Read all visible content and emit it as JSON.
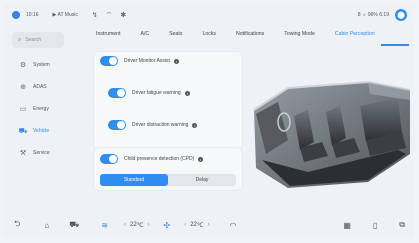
{
  "status_bar": {
    "time": "10:16",
    "media": "▶ AT Music",
    "signal_icon": "signal-icon",
    "wifi_icon": "wifi-icon",
    "bluetooth_icon": "bluetooth-icon",
    "right_text": "8 ☼ 96% 6:19"
  },
  "sidebar": {
    "search_placeholder": "Search",
    "items": [
      {
        "label": "System",
        "icon": "gear-icon"
      },
      {
        "label": "ADAS",
        "icon": "steering-wheel-icon"
      },
      {
        "label": "Energy",
        "icon": "battery-icon"
      },
      {
        "label": "Vehicle",
        "icon": "car-icon",
        "active": true
      },
      {
        "label": "Service",
        "icon": "wrench-icon"
      }
    ]
  },
  "tabs": [
    {
      "label": "Instrument"
    },
    {
      "label": "A/C"
    },
    {
      "label": "Seats"
    },
    {
      "label": "Locks"
    },
    {
      "label": "Notifications"
    },
    {
      "label": "Towing Mode"
    },
    {
      "label": "Cabin Perception",
      "active": true
    }
  ],
  "settings": {
    "driver_monitor": {
      "label": "Driver Monitor Assist",
      "enabled": true
    },
    "driver_fatigue": {
      "label": "Driver fatigue warning",
      "enabled": true
    },
    "driver_distraction": {
      "label": "Driver distraction warning",
      "enabled": true
    },
    "child_presence": {
      "label": "Child presence detection (CPD)",
      "enabled": true
    },
    "cpd_mode": {
      "options": [
        "Standard",
        "Delay"
      ],
      "selected": "Standard"
    }
  },
  "dock": {
    "left_temp": "22",
    "left_temp_unit": "℃",
    "right_temp": "22",
    "right_temp_unit": "℃"
  },
  "colors": {
    "accent": "#2f8cf0",
    "toggle_on": "#2f8cf0"
  }
}
